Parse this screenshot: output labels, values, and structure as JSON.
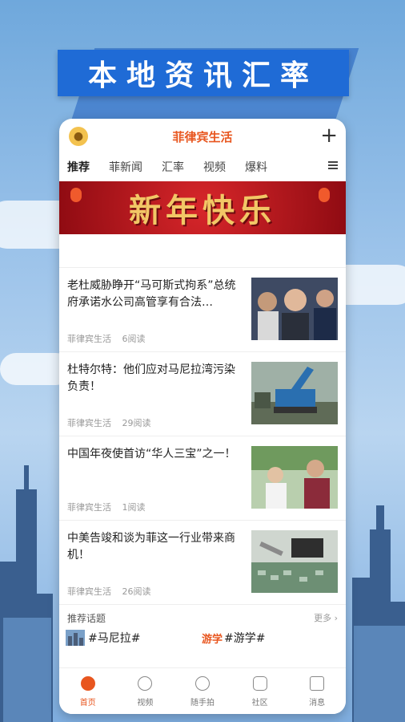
{
  "promo": {
    "title": "本地资讯汇率"
  },
  "app": {
    "title": "菲律宾生活"
  },
  "tabs": [
    "推荐",
    "菲新闻",
    "汇率",
    "视频",
    "爆料"
  ],
  "hero": {
    "text": "新年快乐"
  },
  "news": [
    {
      "title": "老杜威胁睁开“马可斯式拘系”总统府承诺水公司高管享有合法…",
      "source": "菲律宾生活",
      "reads": "6阅读",
      "thumb": "people-photo"
    },
    {
      "title": "杜特尔特：他们应对马尼拉湾污染负责！",
      "source": "菲律宾生活",
      "reads": "29阅读",
      "thumb": "excavator-photo"
    },
    {
      "title": "中国年夜使首访“华人三宝”之一！",
      "source": "菲律宾生活",
      "reads": "1阅读",
      "thumb": "visit-photo"
    },
    {
      "title": "中美告竣和谈为菲这一行业带来商机！",
      "source": "菲律宾生活",
      "reads": "26阅读",
      "thumb": "electronics-photo"
    }
  ],
  "topics": {
    "header": "推荐话题",
    "more": "更多",
    "items": [
      {
        "label": "#马尼拉#",
        "badge": ""
      },
      {
        "label": "#游学#",
        "badge": "游学"
      }
    ]
  },
  "bottom_nav": [
    "首页",
    "视频",
    "随手拍",
    "社区",
    "消息"
  ],
  "colors": {
    "accent": "#e8561f",
    "banner_blue": "#1f6bd6"
  }
}
